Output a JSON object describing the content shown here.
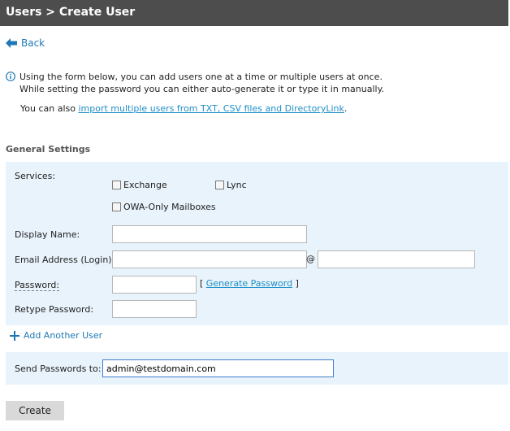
{
  "header": {
    "title": "Users > Create User"
  },
  "nav": {
    "back_label": "Back"
  },
  "info": {
    "line1": "Using the form below, you can add users one at a time or multiple users at once.",
    "line2": "While setting the password you can either auto-generate it or type it in manually.",
    "also_prefix": "You can also ",
    "also_link": "import multiple users from TXT, CSV files and DirectoryLink",
    "also_suffix": "."
  },
  "general": {
    "title": "General Settings",
    "services_label": "Services:",
    "services": {
      "exchange": "Exchange",
      "lync": "Lync",
      "owa": "OWA-Only Mailboxes"
    },
    "display_name_label": "Display Name:",
    "email_label": "Email Address (Login):",
    "at_sign": "@",
    "password_label": "Password:",
    "generate_open": "[",
    "generate_link": "Generate Password",
    "generate_close": "]",
    "retype_label": "Retype Password:"
  },
  "add_user": {
    "label": "Add Another User"
  },
  "send": {
    "label": "Send Passwords to:",
    "value": "admin@testdomain.com"
  },
  "actions": {
    "create_label": "Create"
  }
}
